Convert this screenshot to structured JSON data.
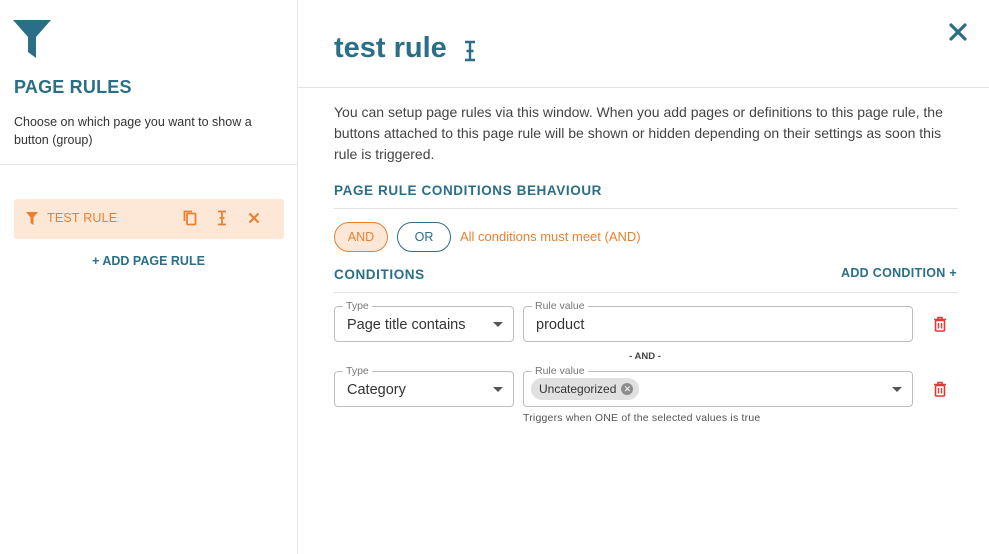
{
  "sidebar": {
    "title": "PAGE RULES",
    "description": "Choose on which page you want to show a button (group)",
    "logo_icon": "filter-icon",
    "rules": [
      {
        "label": "TEST RULE",
        "icon": "filter-icon",
        "actions": [
          "copy-icon",
          "text-cursor-icon",
          "close-icon"
        ]
      }
    ],
    "add_rule_label": "+ ADD PAGE RULE"
  },
  "main": {
    "title": "test rule",
    "intro": "You can setup page rules via this window. When you add pages or definitions to this page rule, the buttons attached to this page rule will be shown or hidden depending on their settings as soon this rule is triggered.",
    "behaviour": {
      "title": "PAGE RULE CONDITIONS BEHAVIOUR",
      "and_label": "AND",
      "or_label": "OR",
      "selected": "AND",
      "note": "All conditions must meet (AND)"
    },
    "conditions": {
      "title": "CONDITIONS",
      "add_label": "ADD CONDITION +",
      "separator_label": "- AND -",
      "items": [
        {
          "type_legend": "Type",
          "type_value": "Page title contains",
          "value_legend": "Rule value",
          "value": "product"
        },
        {
          "type_legend": "Type",
          "type_value": "Category",
          "value_legend": "Rule value",
          "chips": [
            "Uncategorized"
          ],
          "helper": "Triggers when ONE of the selected values is true"
        }
      ]
    }
  },
  "colors": {
    "primary": "#2a6f86",
    "accent": "#e8812f",
    "accent_bg": "#fde8d8",
    "danger": "#e53935"
  }
}
